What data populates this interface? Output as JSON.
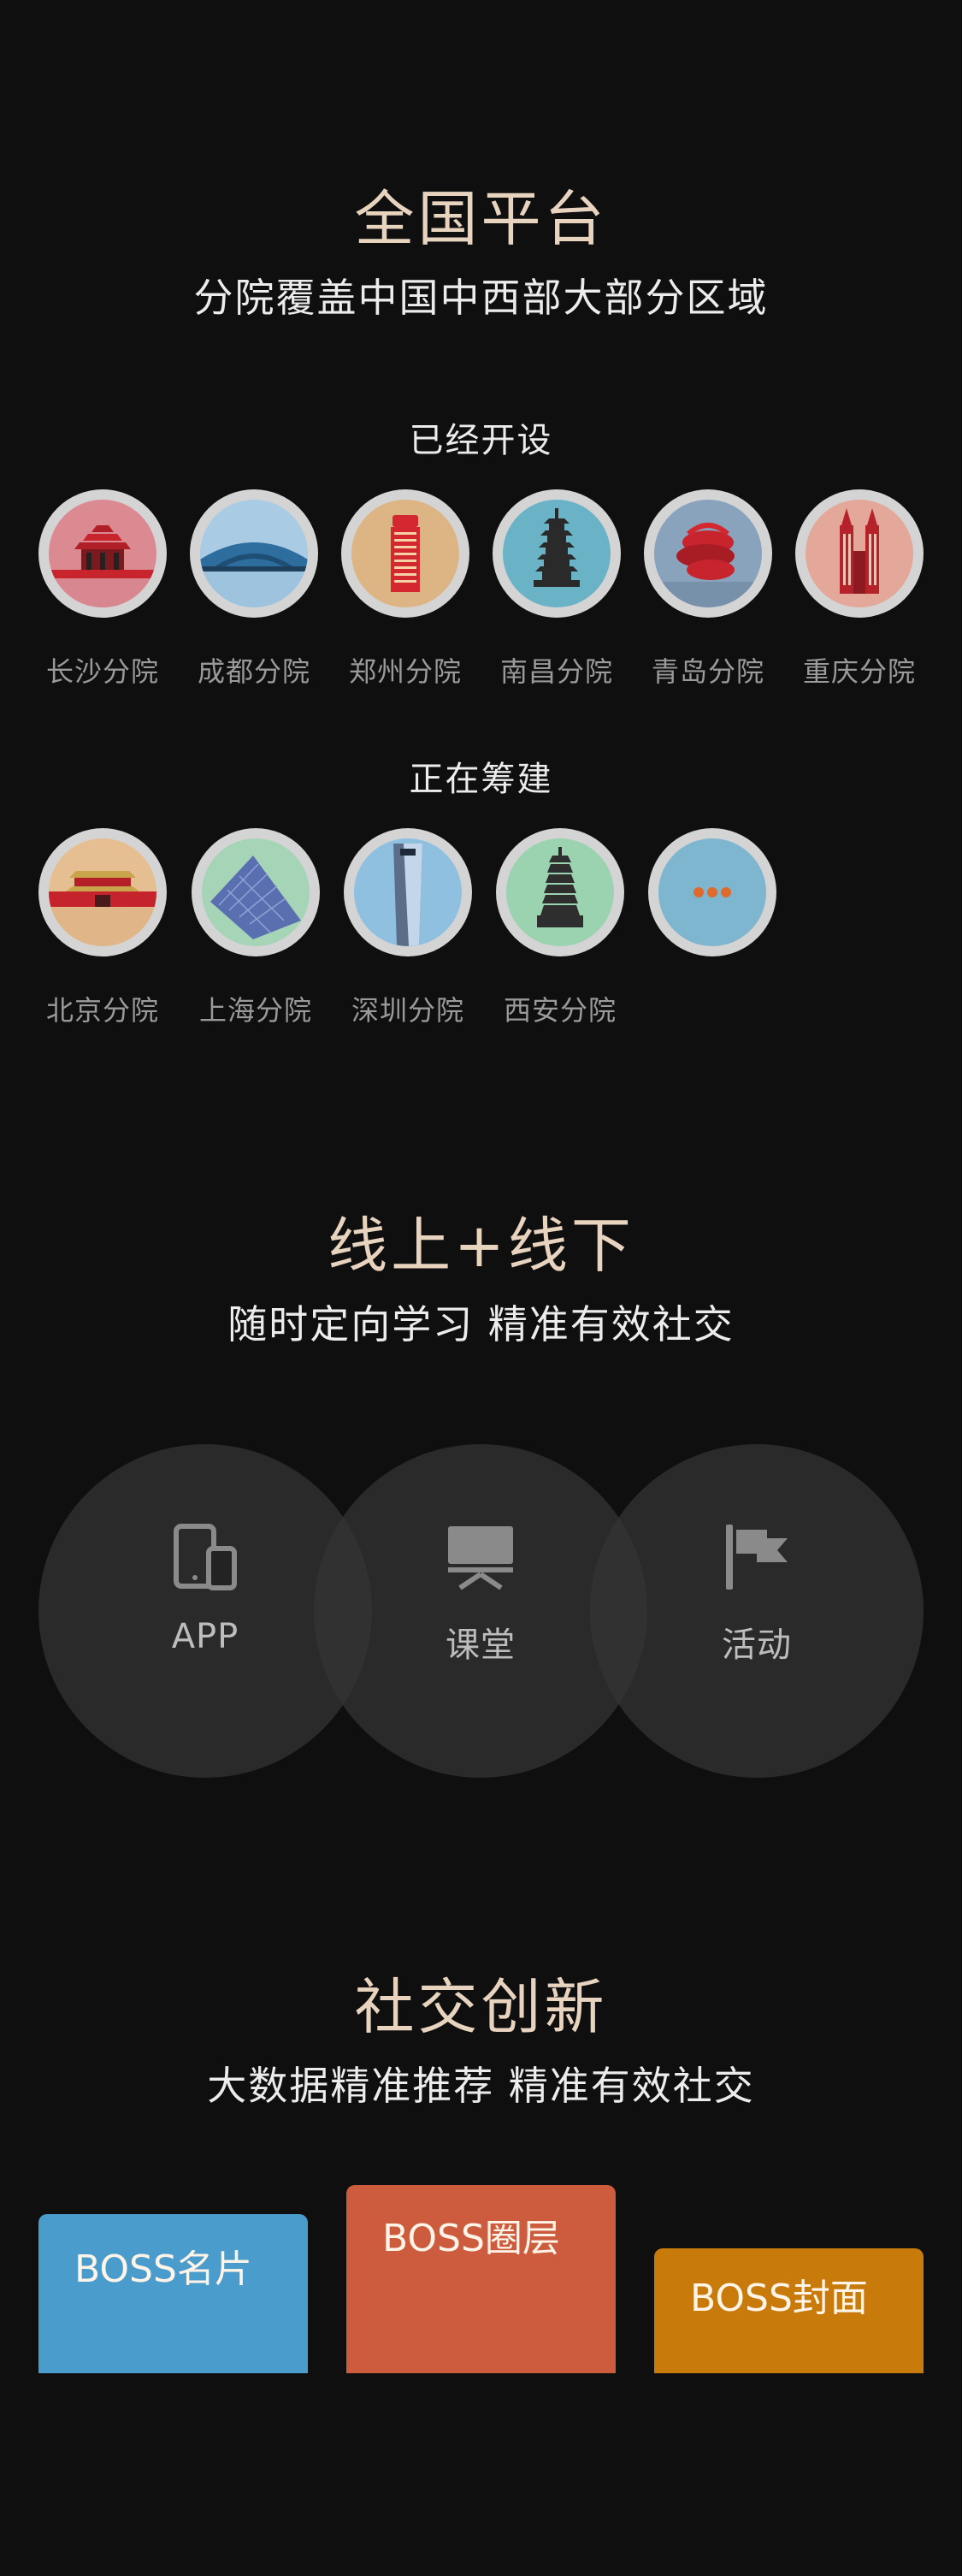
{
  "section_platform": {
    "title": "全国平台",
    "subtitle": "分院覆盖中国中西部大部分区域",
    "opened_heading": "已经开设",
    "opened": [
      {
        "label": "长沙分院",
        "icon": "changsha-landmark-icon"
      },
      {
        "label": "成都分院",
        "icon": "chengdu-landmark-icon"
      },
      {
        "label": "郑州分院",
        "icon": "zhengzhou-landmark-icon"
      },
      {
        "label": "南昌分院",
        "icon": "nanchang-landmark-icon"
      },
      {
        "label": "青岛分院",
        "icon": "qingdao-landmark-icon"
      },
      {
        "label": "重庆分院",
        "icon": "chongqing-landmark-icon"
      }
    ],
    "building_heading": "正在筹建",
    "building": [
      {
        "label": "北京分院",
        "icon": "beijing-landmark-icon"
      },
      {
        "label": "上海分院",
        "icon": "shanghai-landmark-icon"
      },
      {
        "label": "深圳分院",
        "icon": "shenzhen-landmark-icon"
      },
      {
        "label": "西安分院",
        "icon": "xian-landmark-icon"
      },
      {
        "label": "",
        "icon": "more-icon"
      }
    ]
  },
  "section_online": {
    "title": "线上+线下",
    "subtitle": "随时定向学习   精准有效社交",
    "items": [
      {
        "label": "APP",
        "icon": "devices-icon"
      },
      {
        "label": "课堂",
        "icon": "classroom-icon"
      },
      {
        "label": "活动",
        "icon": "flag-icon"
      }
    ]
  },
  "section_social": {
    "title": "社交创新",
    "subtitle": "大数据精准推荐   精准有效社交",
    "cards": [
      {
        "label": "BOSS名片",
        "color": "#4a9ccc"
      },
      {
        "label": "BOSS圈层",
        "color": "#cd5b3d"
      },
      {
        "label": "BOSS封面",
        "color": "#c87b0b"
      }
    ]
  },
  "colors": {
    "background": "#0f0f0f",
    "title": "#e8d3bf",
    "label": "#9a9a9a"
  }
}
